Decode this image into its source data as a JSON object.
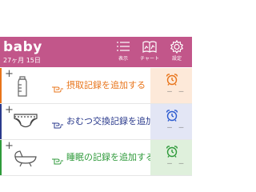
{
  "header": {
    "baby_name": "baby",
    "age": "27ヶ月 15日",
    "colors": {
      "bar": "#c2568a"
    },
    "buttons": [
      {
        "label": "表示",
        "icon": "list-icon"
      },
      {
        "label": "チャート",
        "icon": "book-chart-icon"
      },
      {
        "label": "設定",
        "icon": "gear-icon"
      }
    ]
  },
  "records": [
    {
      "label": "摂取記録を追加する",
      "icon": "bottle-icon",
      "color": "#e8741a",
      "side_color": "#fde9d9",
      "clock_color": "#e8741a",
      "last": "－ －"
    },
    {
      "label": "おむつ交換記録を追加する",
      "icon": "diaper-icon",
      "color": "#2a3a8c",
      "side_color": "#e3e6f5",
      "clock_color": "#2c5bd0",
      "last": "－ －"
    },
    {
      "label": "睡眠の記録を追加する",
      "icon": "bassinet-icon",
      "color": "#2e9a3a",
      "side_color": "#dff0dc",
      "clock_color": "#2e9a3a",
      "last": "－ －"
    }
  ]
}
